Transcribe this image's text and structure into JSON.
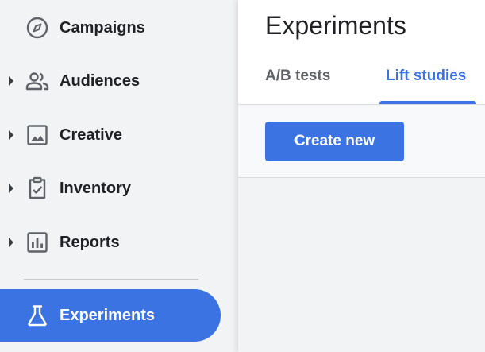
{
  "sidebar": {
    "items": [
      {
        "label": "Campaigns",
        "icon": "compass-icon",
        "expandable": false
      },
      {
        "label": "Audiences",
        "icon": "people-icon",
        "expandable": true
      },
      {
        "label": "Creative",
        "icon": "image-icon",
        "expandable": true
      },
      {
        "label": "Inventory",
        "icon": "clipboard-check-icon",
        "expandable": true
      },
      {
        "label": "Reports",
        "icon": "bar-chart-icon",
        "expandable": true
      },
      {
        "label": "Experiments",
        "icon": "flask-icon",
        "active": true
      }
    ]
  },
  "main": {
    "title": "Experiments",
    "tabs": [
      {
        "label": "A/B tests",
        "selected": false
      },
      {
        "label": "Lift studies",
        "selected": true
      }
    ],
    "create_button": "Create new"
  },
  "colors": {
    "accent": "#3c73e3",
    "background": "#f1f3f4",
    "text": "#202124",
    "icon": "#5f6368"
  }
}
